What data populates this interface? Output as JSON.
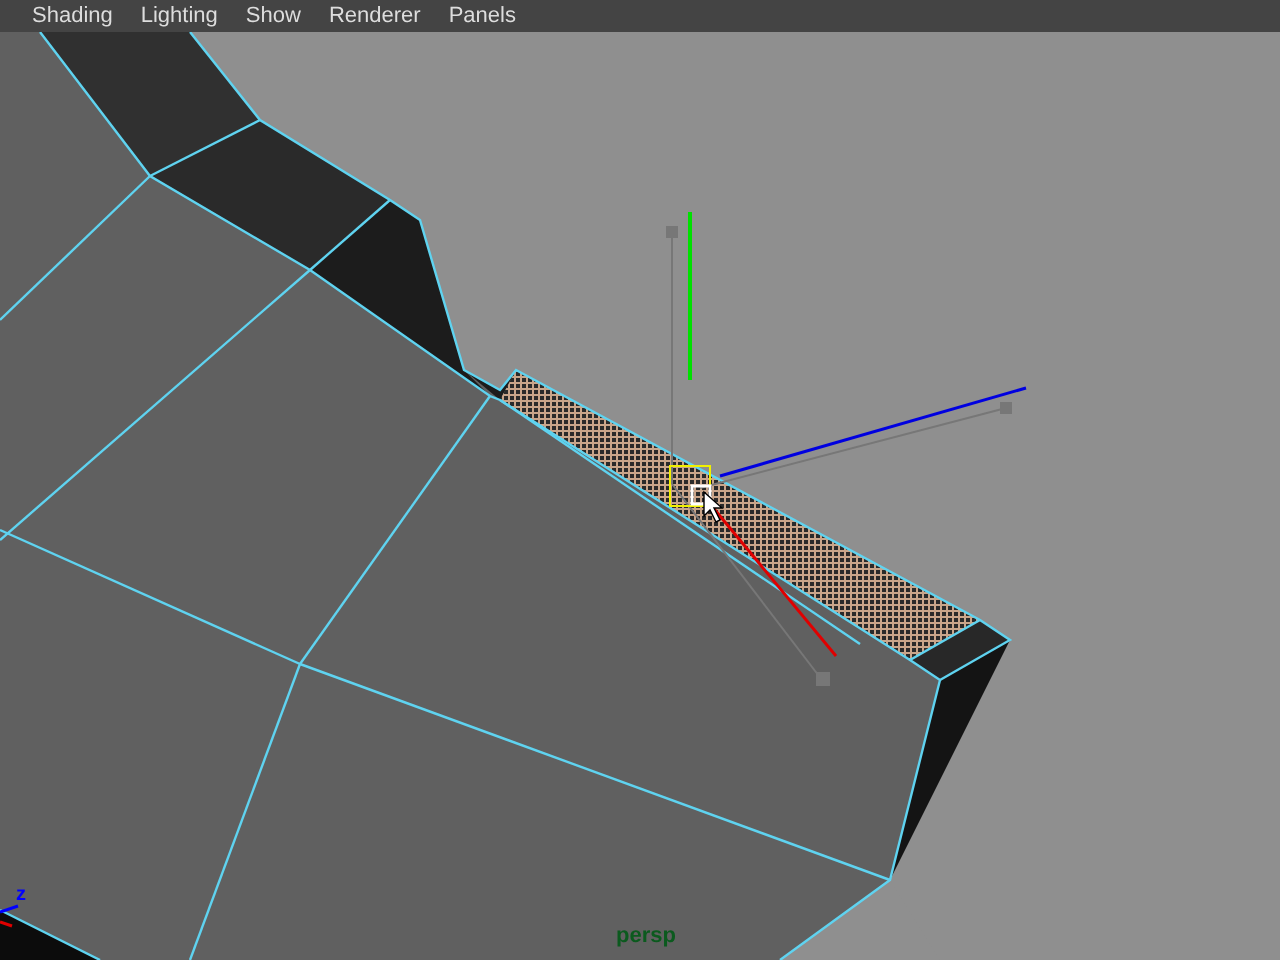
{
  "menu_bar": {
    "items": [
      "Shading",
      "Lighting",
      "Show",
      "Renderer",
      "Panels"
    ]
  },
  "viewport": {
    "camera_label": "persp",
    "axis_label": "z"
  }
}
